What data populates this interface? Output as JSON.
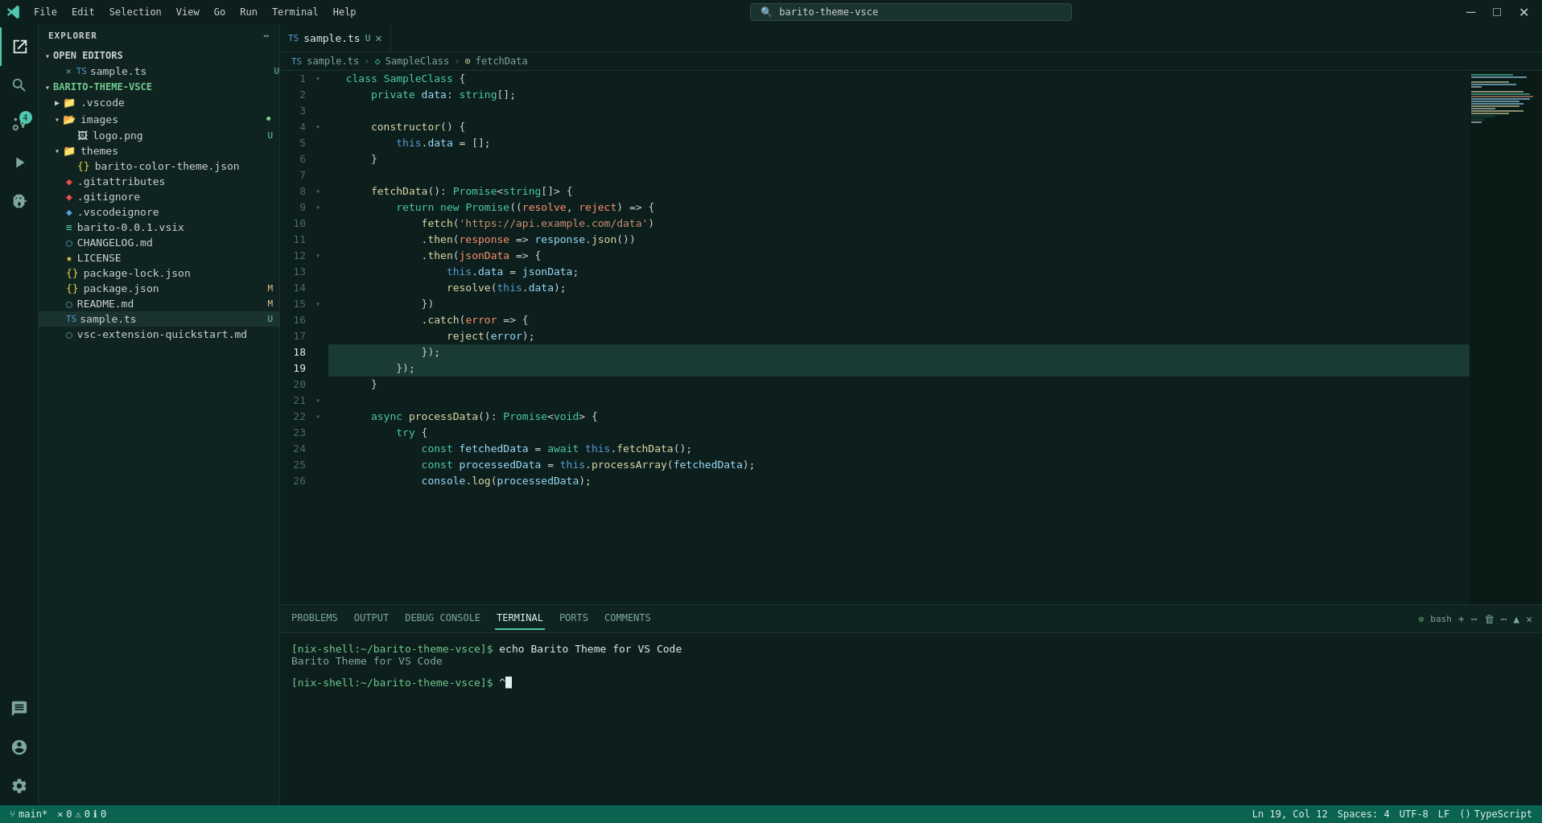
{
  "titlebar": {
    "menus": [
      "File",
      "Edit",
      "Selection",
      "View",
      "Go",
      "Run",
      "Terminal",
      "Help"
    ],
    "search_placeholder": "barito-theme-vsce",
    "nav_back": "←",
    "nav_fwd": "→"
  },
  "sidebar": {
    "title": "EXPLORER",
    "sections": {
      "open_editors": "OPEN EDITORS",
      "project": "BARITO-THEME-VSCE"
    },
    "open_files": [
      {
        "name": "sample.ts",
        "badge": "U",
        "badge_type": "u"
      }
    ],
    "tree": [
      {
        "name": ".vscode",
        "type": "folder",
        "indent": 1
      },
      {
        "name": "images",
        "type": "folder",
        "indent": 1,
        "modified": true
      },
      {
        "name": "logo.png",
        "type": "image",
        "indent": 2,
        "badge": "U",
        "badge_type": "u"
      },
      {
        "name": "themes",
        "type": "folder",
        "indent": 1
      },
      {
        "name": "barito-color-theme.json",
        "type": "json",
        "indent": 2
      },
      {
        "name": ".gitattributes",
        "type": "file",
        "indent": 1
      },
      {
        "name": ".gitignore",
        "type": "file",
        "indent": 1
      },
      {
        "name": ".vscodeignore",
        "type": "file",
        "indent": 1
      },
      {
        "name": "barito-0.0.1.vsix",
        "type": "vsix",
        "indent": 1
      },
      {
        "name": "CHANGELOG.md",
        "type": "md",
        "indent": 1
      },
      {
        "name": "LICENSE",
        "type": "license",
        "indent": 1
      },
      {
        "name": "package-lock.json",
        "type": "json",
        "indent": 1
      },
      {
        "name": "package.json",
        "type": "json",
        "indent": 1,
        "badge": "M",
        "badge_type": "m"
      },
      {
        "name": "README.md",
        "type": "md",
        "indent": 1,
        "badge": "M",
        "badge_type": "m"
      },
      {
        "name": "sample.ts",
        "type": "ts",
        "indent": 1,
        "badge": "U",
        "badge_type": "u",
        "active": true
      },
      {
        "name": "vsc-extension-quickstart.md",
        "type": "md",
        "indent": 1
      }
    ]
  },
  "editor": {
    "tab_name": "sample.ts",
    "breadcrumb": [
      "sample.ts",
      "SampleClass",
      "fetchData"
    ],
    "lines": [
      {
        "num": 1,
        "content": "  class SampleClass {",
        "fold": true
      },
      {
        "num": 2,
        "content": "      private data: string[];",
        "fold": false
      },
      {
        "num": 3,
        "content": "",
        "fold": false
      },
      {
        "num": 4,
        "content": "      constructor() {",
        "fold": true
      },
      {
        "num": 5,
        "content": "          this.data = [];",
        "fold": false
      },
      {
        "num": 6,
        "content": "      }",
        "fold": false
      },
      {
        "num": 7,
        "content": "",
        "fold": false
      },
      {
        "num": 8,
        "content": "      fetchData(): Promise<string[]> {",
        "fold": true
      },
      {
        "num": 9,
        "content": "          return new Promise((resolve, reject) => {",
        "fold": true
      },
      {
        "num": 10,
        "content": "              fetch('https://api.example.com/data')",
        "fold": false
      },
      {
        "num": 11,
        "content": "              .then(response => response.json())",
        "fold": false
      },
      {
        "num": 12,
        "content": "              .then(jsonData => {",
        "fold": true
      },
      {
        "num": 13,
        "content": "                  this.data = jsonData;",
        "fold": false
      },
      {
        "num": 14,
        "content": "                  resolve(this.data);",
        "fold": false
      },
      {
        "num": 15,
        "content": "              })",
        "fold": false
      },
      {
        "num": 16,
        "content": "              .catch(error => {",
        "fold": true
      },
      {
        "num": 17,
        "content": "                  reject(error);",
        "fold": false
      },
      {
        "num": 18,
        "content": "              });",
        "fold": false
      },
      {
        "num": 19,
        "content": "          });",
        "fold": false,
        "active": true
      },
      {
        "num": 20,
        "content": "      }",
        "fold": false
      },
      {
        "num": 21,
        "content": "",
        "fold": false
      },
      {
        "num": 22,
        "content": "      async processData(): Promise<void> {",
        "fold": true
      },
      {
        "num": 23,
        "content": "          try {",
        "fold": true
      },
      {
        "num": 24,
        "content": "              const fetchedData = await this.fetchData();",
        "fold": false
      },
      {
        "num": 25,
        "content": "              const processedData = this.processArray(fetchedData);",
        "fold": false
      },
      {
        "num": 26,
        "content": "              console.log(processedData);",
        "fold": false
      }
    ]
  },
  "panel": {
    "tabs": [
      "PROBLEMS",
      "OUTPUT",
      "DEBUG CONSOLE",
      "TERMINAL",
      "PORTS",
      "COMMENTS"
    ],
    "active_tab": "TERMINAL",
    "terminal": {
      "lines": [
        {
          "type": "prompt",
          "text": "[nix-shell:~/barito-theme-vsce]$ ",
          "cmd": "echo Barito Theme for VS Code"
        },
        {
          "type": "output",
          "text": "Barito Theme for VS Code"
        },
        {
          "type": "prompt2",
          "text": "[nix-shell:~/barito-theme-vsce]$ "
        }
      ]
    },
    "bash_label": "bash"
  },
  "statusbar": {
    "branch": "main*",
    "errors": "0",
    "warnings": "0",
    "info": "0",
    "position": "Ln 19, Col 12",
    "spaces": "Spaces: 4",
    "encoding": "UTF-8",
    "line_ending": "LF",
    "language": "TypeScript"
  },
  "activity_icons": {
    "explorer": "⎇",
    "search": "🔍",
    "source_control": "⑂",
    "run": "▷",
    "extensions": "⊞",
    "chat": "💬",
    "account": "👤",
    "settings": "⚙"
  }
}
